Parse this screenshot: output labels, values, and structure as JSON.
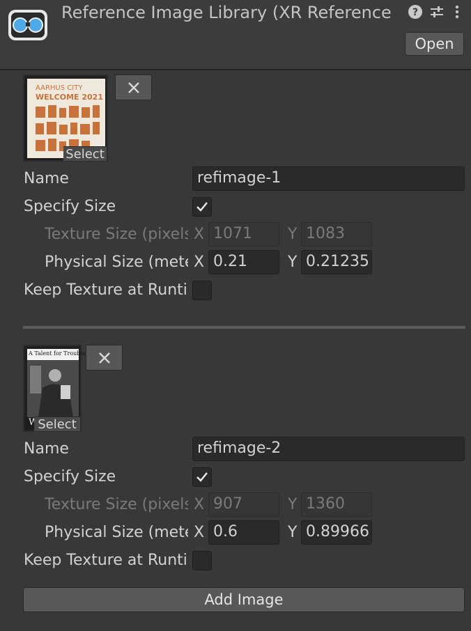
{
  "header": {
    "title": "Reference Image Library (XR Reference Image Library)",
    "open_label": "Open",
    "icons": [
      "help-icon",
      "preset-sliders-icon",
      "kebab-menu-icon"
    ]
  },
  "labels": {
    "name": "Name",
    "specify_size": "Specify Size",
    "texture_size": "Texture Size (pixels)",
    "physical_size": "Physical Size (meters)",
    "keep_texture": "Keep Texture at Runtime",
    "x": "X",
    "y": "Y",
    "select": "Select"
  },
  "images": [
    {
      "name": "refimage-1",
      "specify_size": true,
      "texture_x": "1071",
      "texture_y": "1083",
      "physical_x": "0.21",
      "physical_y": "0.21235",
      "keep_texture": false,
      "thumb_text_line1": "AARHUS CITY",
      "thumb_text_line2": "WELCOME 2021"
    },
    {
      "name": "refimage-2",
      "specify_size": true,
      "texture_x": "907",
      "texture_y": "1360",
      "physical_x": "0.6",
      "physical_y": "0.89966",
      "keep_texture": false,
      "thumb_text_line1": "A Talent for Trouble",
      "thumb_text_line2": "W"
    }
  ],
  "add_image_label": "Add Image",
  "colors": {
    "background": "#383838",
    "thumb1_accent": "#c8723a",
    "field": "#2a2a2a"
  }
}
